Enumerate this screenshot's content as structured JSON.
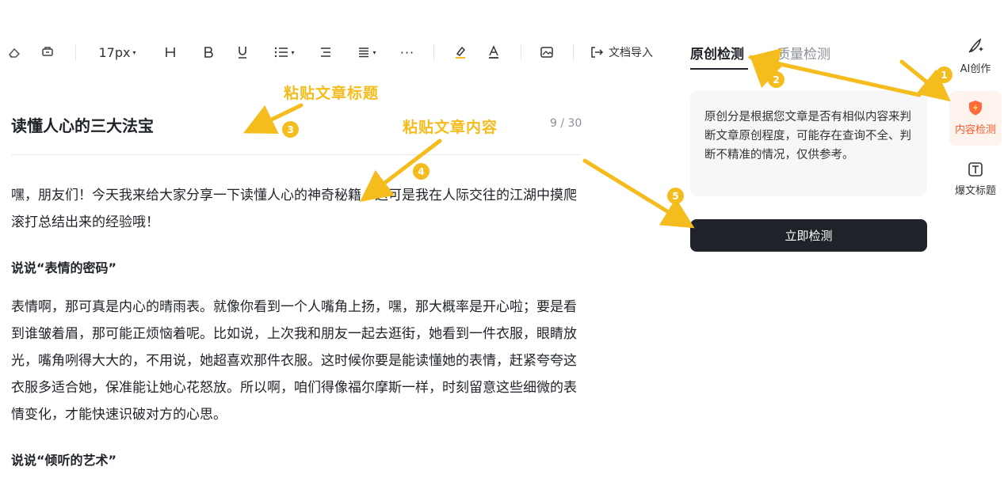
{
  "toolbar": {
    "font_size": "17px",
    "caret": "▾",
    "more": "···",
    "import_label": "文档导入"
  },
  "tabs": [
    {
      "label": "原创检测",
      "active": true
    },
    {
      "label": "质量检测",
      "active": false
    }
  ],
  "editor": {
    "title": "读懂人心的三大法宝",
    "counter": "9 / 30",
    "paragraphs": [
      "嘿，朋友们！今天我来给大家分享一下读懂人心的神奇秘籍，这可是我在人际交往的江湖中摸爬滚打总结出来的经验哦！",
      "表情啊，那可真是内心的晴雨表。就像你看到一个人嘴角上扬，嘿，那大概率是开心啦；要是看到谁皱着眉，那可能正烦恼着呢。比如说，上次我和朋友一起去逛街，她看到一件衣服，眼睛放光，嘴角咧得大大的，不用说，她超喜欢那件衣服。这时候你要是能读懂她的表情，赶紧夸夸这衣服多适合她，保准能让她心花怒放。所以啊，咱们得像福尔摩斯一样，时刻留意这些细微的表情变化，才能快速识破对方的心思。"
    ],
    "headings": [
      "说说“表情的密码”",
      "说说“倾听的艺术”"
    ]
  },
  "panel": {
    "info": "原创分是根据您文章是否有相似内容来判断文章原创程度，可能存在查询不全、判断不精准的情况，仅供参考。",
    "check_button": "立即检测"
  },
  "rail": {
    "items": [
      {
        "label": "AI创作",
        "icon": "ai-pen-icon",
        "active": false
      },
      {
        "label": "内容检测",
        "icon": "shield-icon",
        "active": true
      },
      {
        "label": "爆文标题",
        "icon": "text-box-icon",
        "active": false
      }
    ]
  },
  "annotations": {
    "paste_title": "粘贴文章标题",
    "paste_content": "粘贴文章内容",
    "badges": [
      "1",
      "2",
      "3",
      "4",
      "5"
    ]
  },
  "colors": {
    "accent": "#f5bc1e",
    "button": "#1f2329",
    "active_rail": "#ff5a2c"
  }
}
